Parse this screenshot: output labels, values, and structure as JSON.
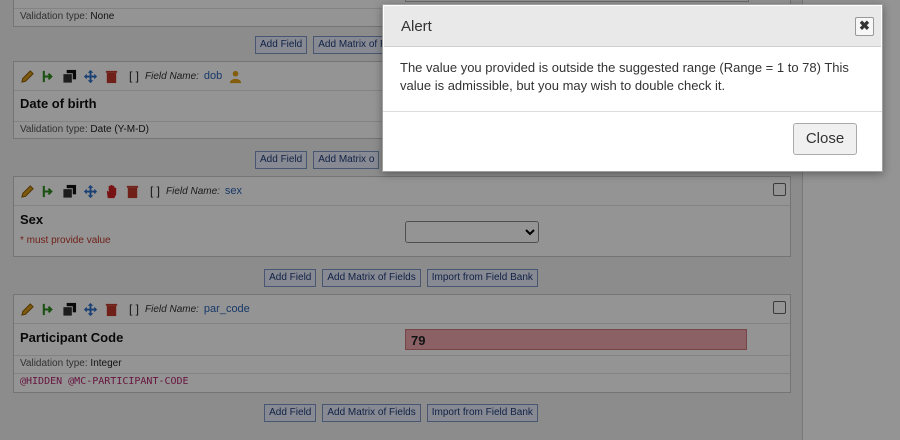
{
  "field_top": {
    "validation_label": "Validation type:",
    "validation_value": "None"
  },
  "buttons": {
    "add_field": "Add Field",
    "add_matrix": "Add Matrix of Fields",
    "import_bank": "Import from Field Bank",
    "add_matrix_partial": "Add Matrix o"
  },
  "field_label_prefix": "Field Name:",
  "dob": {
    "name": "dob",
    "label": "Date of birth",
    "validation_label": "Validation type:",
    "validation_value": "Date (Y-M-D)"
  },
  "sex": {
    "name": "sex",
    "label": "Sex",
    "required": "* must provide value"
  },
  "par_code": {
    "name": "par_code",
    "label": "Participant Code",
    "value": "79",
    "validation_label": "Validation type:",
    "validation_value": "Integer",
    "action_tags": "@HIDDEN @MC-PARTICIPANT-CODE"
  },
  "alert": {
    "title": "Alert",
    "message": "The value you provided is outside the suggested range (Range = 1 to 78) This value is admissible, but you may wish to double check it.",
    "close_label": "Close",
    "close_icon": "close-x-icon"
  },
  "colors": {
    "error_field": "#f0a8ae",
    "link_blue": "#2a62b5",
    "tag_color": "#b3266f"
  }
}
